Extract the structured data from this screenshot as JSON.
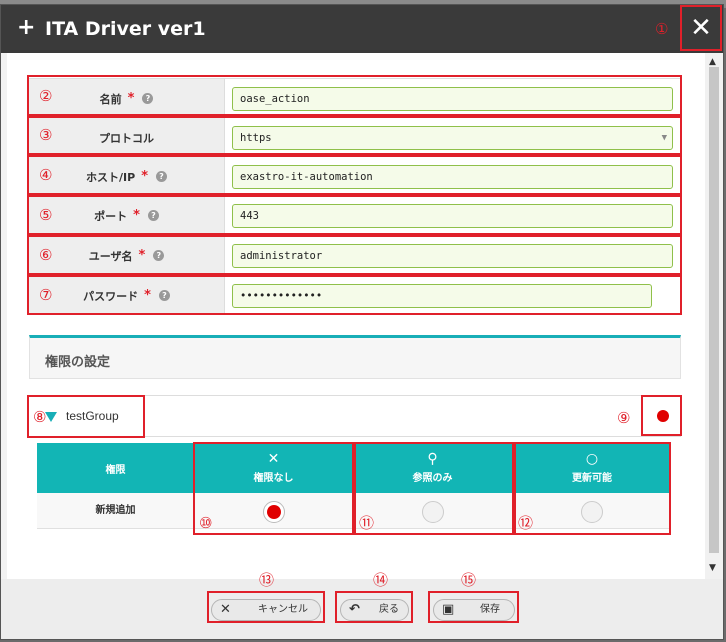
{
  "dialog": {
    "title": "ITA Driver ver1",
    "plus_icon": "plus-icon",
    "close_icon": "close-icon"
  },
  "markers": [
    "①",
    "②",
    "③",
    "④",
    "⑤",
    "⑥",
    "⑦",
    "⑧",
    "⑨",
    "⑩",
    "⑪",
    "⑫",
    "⑬",
    "⑭",
    "⑮"
  ],
  "form": {
    "fields": [
      {
        "label": "名前",
        "required": "*",
        "value": "oase_action"
      },
      {
        "label": "プロトコル",
        "required": "",
        "value": "https"
      },
      {
        "label": "ホスト/IP",
        "required": "*",
        "value": "exastro-it-automation"
      },
      {
        "label": "ポート",
        "required": "*",
        "value": "443"
      },
      {
        "label": "ユーザ名",
        "required": "*",
        "value": "administrator"
      },
      {
        "label": "パスワード",
        "required": "*",
        "value": "•••••••••••••"
      }
    ],
    "help_glyph": "?"
  },
  "permissions": {
    "section_title": "権限の設定",
    "group_name": "testGroup",
    "header_label": "権限",
    "row_label": "新規追加",
    "columns": [
      {
        "icon": "✕",
        "label": "権限なし",
        "selected": true
      },
      {
        "icon": "⚲",
        "label": "参照のみ",
        "selected": false
      },
      {
        "icon": "○",
        "label": "更新可能",
        "selected": false
      }
    ]
  },
  "footer": {
    "cancel_label": "キャンセル",
    "back_label": "戻る",
    "save_label": "保存",
    "cancel_icon": "✕",
    "back_icon": "↶",
    "save_icon": "▣"
  },
  "colors": {
    "accent": "#12b5b5",
    "annotation": "#e0202a",
    "field_border": "#8fc04a",
    "selected_radio": "#e00000"
  }
}
